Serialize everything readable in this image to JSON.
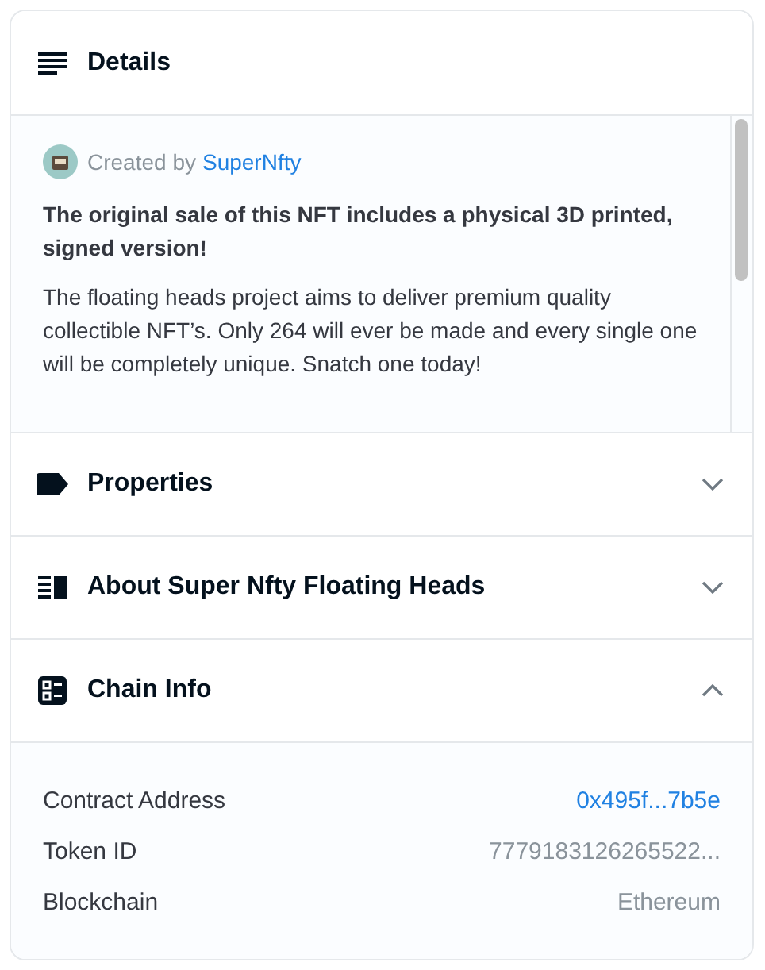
{
  "sections": [
    {
      "kind": "details",
      "title": "Details",
      "expanded": true,
      "creator": {
        "prefix": "Created by",
        "name": "SuperNfty"
      },
      "paragraphs": [
        {
          "bold": true,
          "text": "The original sale of this NFT includes a physical 3D printed, signed version!"
        },
        {
          "bold": false,
          "text": "The floating heads project aims to deliver premium quality collectible NFT’s. Only 264 will ever be made and every single one will be completely unique. Snatch one today!"
        }
      ]
    },
    {
      "kind": "properties",
      "title": "Properties",
      "expanded": false
    },
    {
      "kind": "about",
      "title": "About Super Nfty Floating Heads",
      "expanded": false
    },
    {
      "kind": "chain",
      "title": "Chain Info",
      "expanded": true,
      "rows": [
        {
          "label": "Contract Address",
          "value": "0x495f...7b5e",
          "kind": "link"
        },
        {
          "label": "Token ID",
          "value": "7779183126265522...",
          "kind": "text"
        },
        {
          "label": "Blockchain",
          "value": "Ethereum",
          "kind": "text"
        }
      ]
    }
  ]
}
